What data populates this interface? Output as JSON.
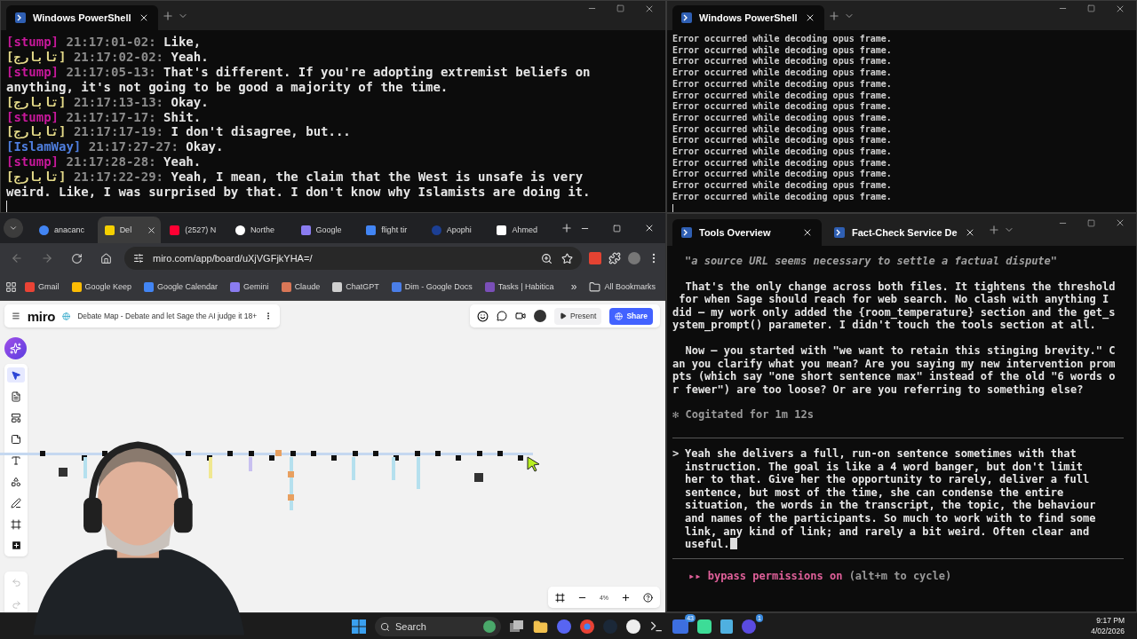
{
  "top_left_terminal": {
    "tabs": [
      {
        "title": "Windows PowerShell",
        "selected": true
      }
    ],
    "lines": [
      {
        "speaker": "[stump]",
        "color": "#c8189b",
        "time": "21:17:01-02:",
        "text": "Like,"
      },
      {
        "speaker": "[تابارج]",
        "color": "#e6dc8a",
        "time": "21:17:02-02:",
        "text": "Yeah."
      },
      {
        "speaker": "[stump]",
        "color": "#c8189b",
        "time": "21:17:05-13:",
        "text": "That's different. If you're adopting extremist beliefs on anything, it's not going to be good a majority of the time."
      },
      {
        "speaker": "[تابارج]",
        "color": "#e6dc8a",
        "time": "21:17:13-13:",
        "text": "Okay."
      },
      {
        "speaker": "[stump]",
        "color": "#c8189b",
        "time": "21:17:17-17:",
        "text": "Shit."
      },
      {
        "speaker": "[تابارج]",
        "color": "#e6dc8a",
        "time": "21:17:17-19:",
        "text": "I don't disagree, but..."
      },
      {
        "speaker": "[IslamWay]",
        "color": "#4f7fe0",
        "time": "21:17:27-27:",
        "text": "Okay."
      },
      {
        "speaker": "[stump]",
        "color": "#c8189b",
        "time": "21:17:28-28:",
        "text": "Yeah."
      },
      {
        "speaker": "[تابارج]",
        "color": "#e6dc8a",
        "time": "21:17:22-29:",
        "text": "Yeah, I mean, the claim that the West is unsafe is very weird. Like, I was surprised by that. I don't know why Islamists are doing it."
      }
    ]
  },
  "top_right_terminal": {
    "tabs": [
      {
        "title": "Windows PowerShell",
        "selected": true
      }
    ],
    "lines": [
      "Error occurred while decoding opus frame.",
      "Error occurred while decoding opus frame.",
      "Error occurred while decoding opus frame.",
      "Error occurred while decoding opus frame.",
      "Error occurred while decoding opus frame.",
      "Error occurred while decoding opus frame.",
      "Error occurred while decoding opus frame.",
      "Error occurred while decoding opus frame.",
      "Error occurred while decoding opus frame.",
      "Error occurred while decoding opus frame.",
      "Error occurred while decoding opus frame.",
      "Error occurred while decoding opus frame.",
      "Error occurred while decoding opus frame.",
      "Error occurred while decoding opus frame.",
      "Error occurred while decoding opus frame."
    ]
  },
  "browser": {
    "tabs": [
      {
        "title": "anacanc",
        "selected": false
      },
      {
        "title": "Del",
        "selected": true
      },
      {
        "title": "(2527) N",
        "selected": false
      },
      {
        "title": "Northe",
        "selected": false
      },
      {
        "title": "Google",
        "selected": false
      },
      {
        "title": "flight tir",
        "selected": false
      },
      {
        "title": "Apophi",
        "selected": false
      },
      {
        "title": "Ahmed",
        "selected": false
      }
    ],
    "url": "miro.com/app/board/uXjVGFjkYHA=/",
    "bookmarks": [
      "Gmail",
      "Google Keep",
      "Google Calendar",
      "Gemini",
      "Claude",
      "ChatGPT",
      "Dim - Google Docs",
      "Tasks | Habitica"
    ],
    "bookmarks_more": "»",
    "all_bookmarks": "All Bookmarks",
    "miro": {
      "logo": "miro",
      "board_title": "Debate Map - Debate and let Sage the AI judge it 18+",
      "present": "Present",
      "share": "Share",
      "zoom": "4%"
    }
  },
  "bottom_right_terminal": {
    "tabs": [
      {
        "title": "Tools Overview",
        "selected": true
      },
      {
        "title": "Fact-Check Service De",
        "selected": false
      }
    ],
    "blocks": [
      {
        "kind": "quote",
        "text": "\"a source URL seems necessary to settle a factual dispute\""
      },
      {
        "kind": "text",
        "text": "  That's the only change across both files. It tightens the threshold\n for when Sage should reach for web search. No clash with anything I\ndid – my work only added the {room_temperature} section and the get_s\nystem_prompt() parameter. I didn't touch the tools section at all."
      },
      {
        "kind": "text",
        "text": "  Now – you started with \"we want to retain this stinging brevity.\" C\nan you clarify what you mean? Are you saying my new intervention prom\npts (which say \"one short sentence max\" instead of the old \"6 words o\nr fewer\") are too loose? Or are you referring to something else?"
      },
      {
        "kind": "status",
        "marker": "✻",
        "text": "Cogitated for 1m 12s"
      },
      {
        "kind": "prompt",
        "marker": ">",
        "text": "Yeah she delivers a full, run-on sentence sometimes with that\ninstruction. The goal is like a 4 word banger, but don't limit\nher to that. Give her the opportunity to rarely, deliver a full\nsentence, but most of the time, she can condense the entire\nsituation, the words in the transcript, the topic, the behaviour\nand names of the participants. So much to work with to find some\nlink, any kind of link; and rarely a bit weird. Often clear and\nuseful."
      },
      {
        "kind": "mode",
        "marker": "▸▸",
        "text": "bypass permissions on",
        "hint": "(alt+m to cycle)"
      }
    ]
  },
  "taskbar": {
    "search": "Search",
    "badges": [
      "43",
      "1"
    ],
    "time": "9:17 PM",
    "date": "4/02/2026"
  }
}
